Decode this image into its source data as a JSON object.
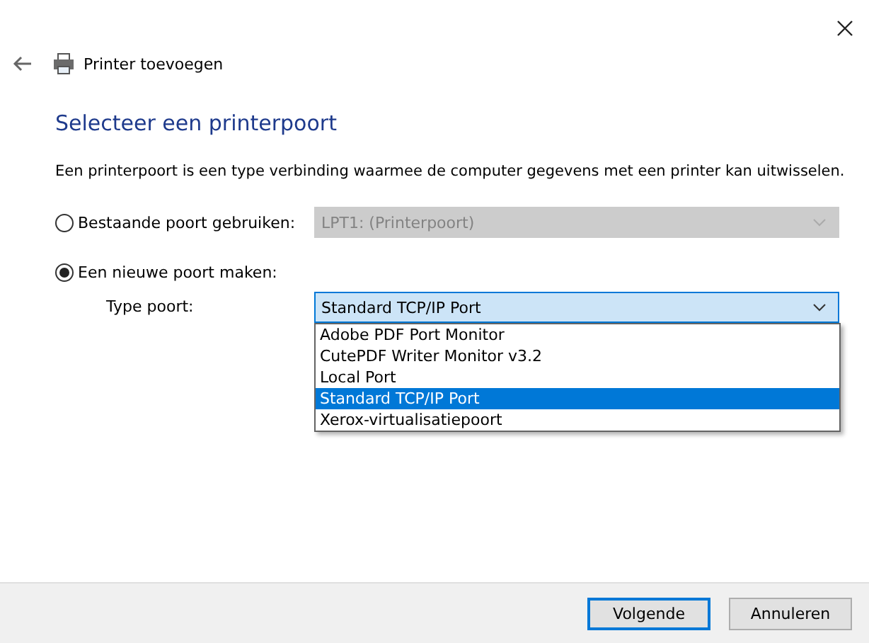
{
  "window": {
    "title": "Printer toevoegen"
  },
  "heading": "Selecteer een printerpoort",
  "description": "Een printerpoort is een type verbinding waarmee de computer gegevens met een printer kan uitwisselen.",
  "options": [
    {
      "label": "Bestaande poort gebruiken:",
      "selected": false,
      "combo": {
        "value": "LPT1: (Printerpoort)",
        "disabled": true
      }
    },
    {
      "label": "Een nieuwe poort maken:",
      "selected": true
    }
  ],
  "port_type": {
    "label": "Type poort:",
    "value": "Standard TCP/IP Port",
    "expanded": true,
    "items": [
      {
        "label": "Adobe PDF Port Monitor",
        "selected": false
      },
      {
        "label": "CutePDF Writer Monitor v3.2",
        "selected": false
      },
      {
        "label": "Local Port",
        "selected": false
      },
      {
        "label": "Standard TCP/IP Port",
        "selected": true
      },
      {
        "label": "Xerox-virtualisatiepoort",
        "selected": false
      }
    ]
  },
  "buttons": [
    {
      "label": "Volgende",
      "default": true
    },
    {
      "label": "Annuleren",
      "default": false
    }
  ]
}
